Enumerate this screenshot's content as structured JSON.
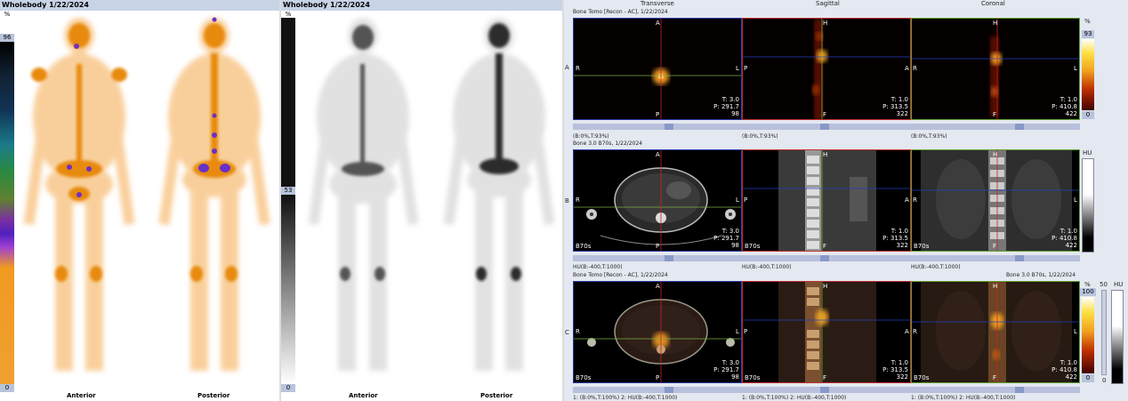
{
  "wholebody_color": {
    "title": "Wholebody 1/22/2024",
    "scale_unit": "%",
    "scale_max": "96",
    "scale_min": "0",
    "view_anterior": "Anterior",
    "view_posterior": "Posterior"
  },
  "wholebody_gray": {
    "title": "Wholebody 1/22/2024",
    "scale_unit": "%",
    "scale_max": "53",
    "scale_min": "0",
    "view_anterior": "Anterior",
    "view_posterior": "Posterior"
  },
  "tomo": {
    "col_headers": [
      "Transverse",
      "Sagittal",
      "Coronal"
    ],
    "row_labels": [
      "A",
      "B",
      "C"
    ],
    "row_a": {
      "caption": "Bone Tomo [Recon - AC], 1/22/2024",
      "colorbar_unit": "%",
      "colorbar_max": "93",
      "colorbar_min": "0",
      "transverse": {
        "top": "A",
        "left": "R",
        "right": "L",
        "bottom": "P",
        "info": [
          "T: 3.0",
          "P: 291.7",
          "98"
        ],
        "under": "(B:0%,T:93%)"
      },
      "sagittal": {
        "top": "H",
        "left": "P",
        "right": "A",
        "bottom": "F",
        "info": [
          "T: 1.0",
          "P: 313.5",
          "322"
        ],
        "under": "(B:0%,T:93%)"
      },
      "coronal": {
        "top": "H",
        "left": "R",
        "right": "L",
        "bottom": "F",
        "info": [
          "T: 1.0",
          "P: 410.8",
          "422"
        ],
        "under": "(B:0%,T:93%)"
      }
    },
    "row_b": {
      "caption": "Bone 3.0 B70s, 1/22/2024",
      "colorbar_unit": "HU",
      "transverse": {
        "top": "A",
        "left": "R",
        "right": "L",
        "bottom": "P",
        "info": [
          "T: 3.0",
          "P: 291.7",
          "98"
        ],
        "corner": "B70s",
        "under": "HU(B:-400,T:1000)"
      },
      "sagittal": {
        "top": "H",
        "left": "P",
        "right": "A",
        "bottom": "F",
        "info": [
          "T: 1.0",
          "P: 313.5",
          "322"
        ],
        "corner": "B70s",
        "under": "HU(B:-400,T:1000)"
      },
      "coronal": {
        "top": "H",
        "left": "R",
        "right": "L",
        "bottom": "F",
        "info": [
          "T: 1.0",
          "P: 410.8",
          "422"
        ],
        "corner": "B70s",
        "under": "HU(B:-400,T:1000)"
      }
    },
    "row_c": {
      "caption_left": "Bone Tomo [Recon - AC], 1/22/2024",
      "caption_right": "Bone 3.0 B70s, 1/22/2024",
      "colorbar_unit": "%",
      "colorbar_max": "100",
      "colorbar_min": "0",
      "fusion_value": "50",
      "fusion_min": "0",
      "hu_unit": "HU",
      "transverse": {
        "top": "A",
        "left": "R",
        "right": "L",
        "bottom": "P",
        "info": [
          "T: 3.0",
          "P: 291.7",
          "98"
        ],
        "corner": "B70s",
        "under": "1: (B:0%,T:100%)    2: HU(B:-400,T:1000)"
      },
      "sagittal": {
        "top": "H",
        "left": "P",
        "right": "A",
        "bottom": "F",
        "info": [
          "T: 1.0",
          "P: 313.5",
          "322"
        ],
        "corner": "B70s",
        "under": "1: (B:0%,T:100%)    2: HU(B:-400,T:1000)"
      },
      "coronal": {
        "top": "H",
        "left": "R",
        "right": "L",
        "bottom": "F",
        "info": [
          "T: 1.0",
          "P: 410.8",
          "422"
        ],
        "corner": "B70s",
        "under": "1: (B:0%,T:100%)    2: HU(B:-400,T:1000)"
      }
    }
  },
  "colors": {
    "title_bar": "#c8d4e6",
    "hot_orange": "#f29a1e",
    "crosshair_red": "#d02020",
    "crosshair_green": "#7ab040",
    "crosshair_blue": "#2040c0"
  }
}
